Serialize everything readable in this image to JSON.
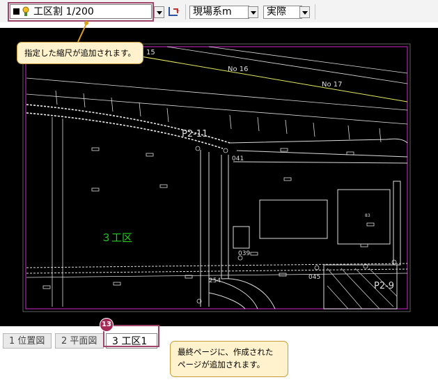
{
  "toolbar": {
    "layer_name": "工区割 1/200",
    "coordinate_system": "現場系m",
    "scale_mode": "実際",
    "icons": [
      "layer-swatch-icon",
      "layer-lock-icon",
      "dropdown-arrow-icon",
      "scale-tool-icon"
    ]
  },
  "drawing": {
    "background": "#000000",
    "labels": {
      "no15": "15",
      "no16": "No 16",
      "no17": "No 17",
      "p2_11": "P2-11",
      "p2_9": "P2-9",
      "n041": "041",
      "n039": "039",
      "n045": "045",
      "n254": "254",
      "n83": "83",
      "area_name": "３工区"
    },
    "colors": {
      "sheet_border": "#a020a0",
      "station_line": "#e8e860",
      "area_label": "#22cc22",
      "linework": "#e8e8e8"
    }
  },
  "tabs": [
    {
      "label": "1 位置図",
      "active": false
    },
    {
      "label": "2 平面図",
      "active": false
    },
    {
      "label": "3 工区1",
      "active": true
    }
  ],
  "annotations": {
    "callout_scale": "指定した縮尺が追加されます。",
    "callout_page": [
      "最終ページに、作成された",
      "ページが追加されます。"
    ],
    "step_badge": "13",
    "highlight_color": "#a0456a"
  }
}
